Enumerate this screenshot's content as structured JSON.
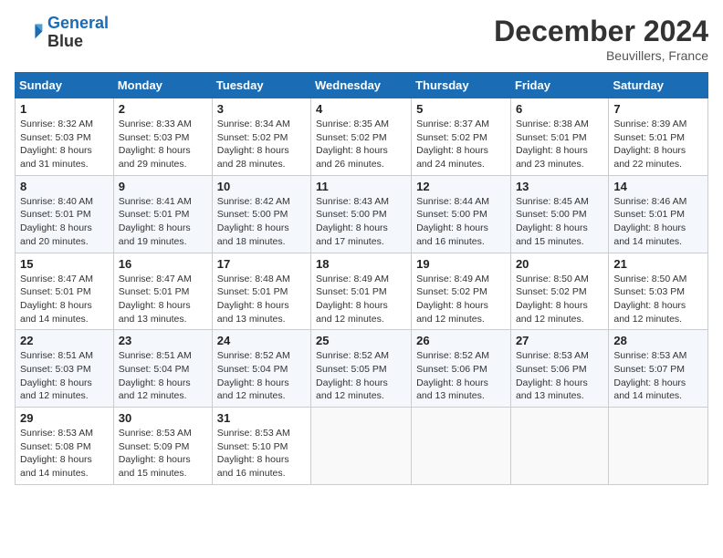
{
  "header": {
    "logo_line1": "General",
    "logo_line2": "Blue",
    "month_title": "December 2024",
    "location": "Beuvillers, France"
  },
  "weekdays": [
    "Sunday",
    "Monday",
    "Tuesday",
    "Wednesday",
    "Thursday",
    "Friday",
    "Saturday"
  ],
  "weeks": [
    [
      {
        "day": "1",
        "sunrise": "Sunrise: 8:32 AM",
        "sunset": "Sunset: 5:03 PM",
        "daylight": "Daylight: 8 hours and 31 minutes."
      },
      {
        "day": "2",
        "sunrise": "Sunrise: 8:33 AM",
        "sunset": "Sunset: 5:03 PM",
        "daylight": "Daylight: 8 hours and 29 minutes."
      },
      {
        "day": "3",
        "sunrise": "Sunrise: 8:34 AM",
        "sunset": "Sunset: 5:02 PM",
        "daylight": "Daylight: 8 hours and 28 minutes."
      },
      {
        "day": "4",
        "sunrise": "Sunrise: 8:35 AM",
        "sunset": "Sunset: 5:02 PM",
        "daylight": "Daylight: 8 hours and 26 minutes."
      },
      {
        "day": "5",
        "sunrise": "Sunrise: 8:37 AM",
        "sunset": "Sunset: 5:02 PM",
        "daylight": "Daylight: 8 hours and 24 minutes."
      },
      {
        "day": "6",
        "sunrise": "Sunrise: 8:38 AM",
        "sunset": "Sunset: 5:01 PM",
        "daylight": "Daylight: 8 hours and 23 minutes."
      },
      {
        "day": "7",
        "sunrise": "Sunrise: 8:39 AM",
        "sunset": "Sunset: 5:01 PM",
        "daylight": "Daylight: 8 hours and 22 minutes."
      }
    ],
    [
      {
        "day": "8",
        "sunrise": "Sunrise: 8:40 AM",
        "sunset": "Sunset: 5:01 PM",
        "daylight": "Daylight: 8 hours and 20 minutes."
      },
      {
        "day": "9",
        "sunrise": "Sunrise: 8:41 AM",
        "sunset": "Sunset: 5:01 PM",
        "daylight": "Daylight: 8 hours and 19 minutes."
      },
      {
        "day": "10",
        "sunrise": "Sunrise: 8:42 AM",
        "sunset": "Sunset: 5:00 PM",
        "daylight": "Daylight: 8 hours and 18 minutes."
      },
      {
        "day": "11",
        "sunrise": "Sunrise: 8:43 AM",
        "sunset": "Sunset: 5:00 PM",
        "daylight": "Daylight: 8 hours and 17 minutes."
      },
      {
        "day": "12",
        "sunrise": "Sunrise: 8:44 AM",
        "sunset": "Sunset: 5:00 PM",
        "daylight": "Daylight: 8 hours and 16 minutes."
      },
      {
        "day": "13",
        "sunrise": "Sunrise: 8:45 AM",
        "sunset": "Sunset: 5:00 PM",
        "daylight": "Daylight: 8 hours and 15 minutes."
      },
      {
        "day": "14",
        "sunrise": "Sunrise: 8:46 AM",
        "sunset": "Sunset: 5:01 PM",
        "daylight": "Daylight: 8 hours and 14 minutes."
      }
    ],
    [
      {
        "day": "15",
        "sunrise": "Sunrise: 8:47 AM",
        "sunset": "Sunset: 5:01 PM",
        "daylight": "Daylight: 8 hours and 14 minutes."
      },
      {
        "day": "16",
        "sunrise": "Sunrise: 8:47 AM",
        "sunset": "Sunset: 5:01 PM",
        "daylight": "Daylight: 8 hours and 13 minutes."
      },
      {
        "day": "17",
        "sunrise": "Sunrise: 8:48 AM",
        "sunset": "Sunset: 5:01 PM",
        "daylight": "Daylight: 8 hours and 13 minutes."
      },
      {
        "day": "18",
        "sunrise": "Sunrise: 8:49 AM",
        "sunset": "Sunset: 5:01 PM",
        "daylight": "Daylight: 8 hours and 12 minutes."
      },
      {
        "day": "19",
        "sunrise": "Sunrise: 8:49 AM",
        "sunset": "Sunset: 5:02 PM",
        "daylight": "Daylight: 8 hours and 12 minutes."
      },
      {
        "day": "20",
        "sunrise": "Sunrise: 8:50 AM",
        "sunset": "Sunset: 5:02 PM",
        "daylight": "Daylight: 8 hours and 12 minutes."
      },
      {
        "day": "21",
        "sunrise": "Sunrise: 8:50 AM",
        "sunset": "Sunset: 5:03 PM",
        "daylight": "Daylight: 8 hours and 12 minutes."
      }
    ],
    [
      {
        "day": "22",
        "sunrise": "Sunrise: 8:51 AM",
        "sunset": "Sunset: 5:03 PM",
        "daylight": "Daylight: 8 hours and 12 minutes."
      },
      {
        "day": "23",
        "sunrise": "Sunrise: 8:51 AM",
        "sunset": "Sunset: 5:04 PM",
        "daylight": "Daylight: 8 hours and 12 minutes."
      },
      {
        "day": "24",
        "sunrise": "Sunrise: 8:52 AM",
        "sunset": "Sunset: 5:04 PM",
        "daylight": "Daylight: 8 hours and 12 minutes."
      },
      {
        "day": "25",
        "sunrise": "Sunrise: 8:52 AM",
        "sunset": "Sunset: 5:05 PM",
        "daylight": "Daylight: 8 hours and 12 minutes."
      },
      {
        "day": "26",
        "sunrise": "Sunrise: 8:52 AM",
        "sunset": "Sunset: 5:06 PM",
        "daylight": "Daylight: 8 hours and 13 minutes."
      },
      {
        "day": "27",
        "sunrise": "Sunrise: 8:53 AM",
        "sunset": "Sunset: 5:06 PM",
        "daylight": "Daylight: 8 hours and 13 minutes."
      },
      {
        "day": "28",
        "sunrise": "Sunrise: 8:53 AM",
        "sunset": "Sunset: 5:07 PM",
        "daylight": "Daylight: 8 hours and 14 minutes."
      }
    ],
    [
      {
        "day": "29",
        "sunrise": "Sunrise: 8:53 AM",
        "sunset": "Sunset: 5:08 PM",
        "daylight": "Daylight: 8 hours and 14 minutes."
      },
      {
        "day": "30",
        "sunrise": "Sunrise: 8:53 AM",
        "sunset": "Sunset: 5:09 PM",
        "daylight": "Daylight: 8 hours and 15 minutes."
      },
      {
        "day": "31",
        "sunrise": "Sunrise: 8:53 AM",
        "sunset": "Sunset: 5:10 PM",
        "daylight": "Daylight: 8 hours and 16 minutes."
      },
      null,
      null,
      null,
      null
    ]
  ]
}
